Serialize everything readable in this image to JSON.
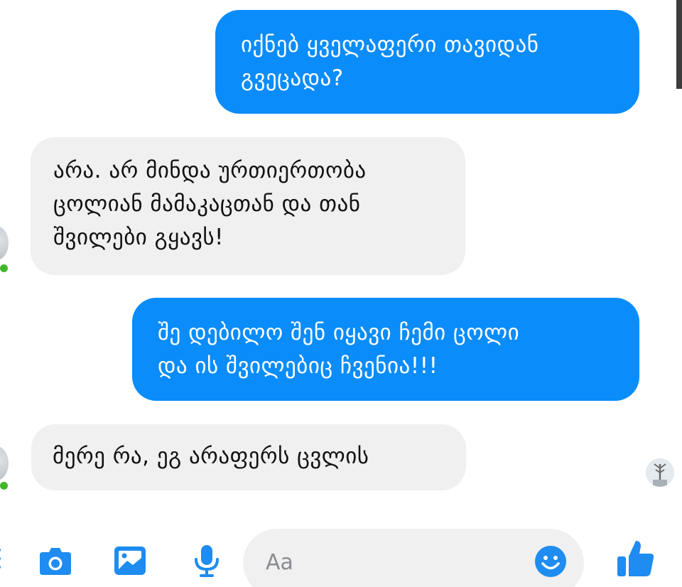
{
  "conversation": {
    "messages": [
      {
        "direction": "outgoing",
        "text": "იქნებ ყველაფერი თავიდან\nგვეცადა?"
      },
      {
        "direction": "incoming",
        "text": "არა. არ მინდა ურთიერთობა\nცოლიან მამაკაცთან და თან\nშვილები გყავს!"
      },
      {
        "direction": "outgoing",
        "text": "შე დებილო შენ იყავი ჩემი ცოლი\nდა ის შვილებიც ჩვენია!!!"
      },
      {
        "direction": "incoming",
        "text": "მერე რა, ეგ არაფერს ცვლის"
      }
    ]
  },
  "composer": {
    "placeholder": "Aa"
  },
  "toolbar": {
    "icons": [
      "camera-icon",
      "image-icon",
      "microphone-icon",
      "emoji-icon",
      "thumbs-up-icon"
    ]
  },
  "colors": {
    "outgoing_bubble": "#0a8cfa",
    "incoming_bubble": "#f1f0f0",
    "accent": "#1e8cf0",
    "online": "#42b72a"
  }
}
